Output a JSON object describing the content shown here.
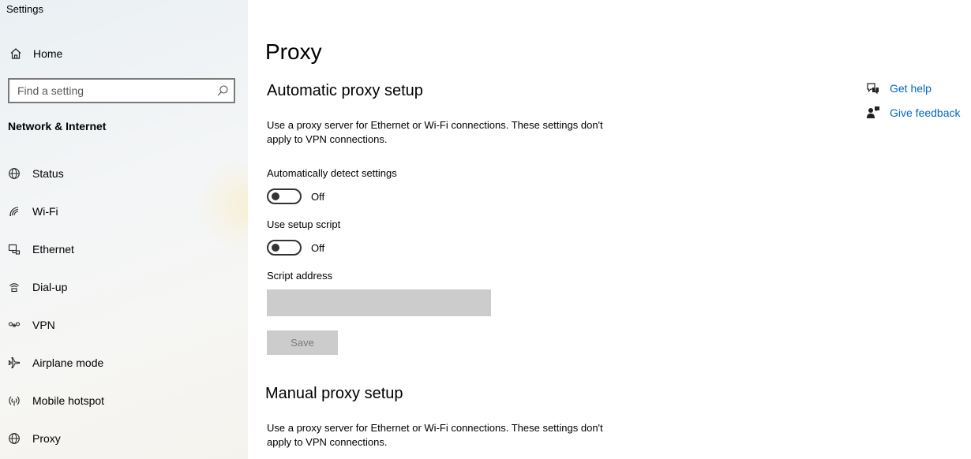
{
  "window": {
    "title": "Settings"
  },
  "sidebar": {
    "home": {
      "label": "Home",
      "icon": "home-icon"
    },
    "search": {
      "placeholder": "Find a setting",
      "value": ""
    },
    "section_title": "Network & Internet",
    "items": [
      {
        "label": "Status",
        "icon": "globe-icon"
      },
      {
        "label": "Wi-Fi",
        "icon": "wifi-icon"
      },
      {
        "label": "Ethernet",
        "icon": "ethernet-icon"
      },
      {
        "label": "Dial-up",
        "icon": "dialup-icon"
      },
      {
        "label": "VPN",
        "icon": "vpn-icon"
      },
      {
        "label": "Airplane mode",
        "icon": "airplane-icon"
      },
      {
        "label": "Mobile hotspot",
        "icon": "hotspot-icon"
      },
      {
        "label": "Proxy",
        "icon": "globe-icon"
      }
    ]
  },
  "main": {
    "title": "Proxy",
    "automatic": {
      "heading": "Automatic proxy setup",
      "description": "Use a proxy server for Ethernet or Wi-Fi connections. These settings don't apply to VPN connections.",
      "detect": {
        "label": "Automatically detect settings",
        "state": "Off",
        "on": false
      },
      "script": {
        "label": "Use setup script",
        "state": "Off",
        "on": false
      },
      "script_address": {
        "label": "Script address",
        "value": ""
      },
      "save_label": "Save"
    },
    "manual": {
      "heading": "Manual proxy setup",
      "description": "Use a proxy server for Ethernet or Wi-Fi connections. These settings don't apply to VPN connections."
    }
  },
  "help": {
    "get_help": "Get help",
    "give_feedback": "Give feedback"
  },
  "colors": {
    "link": "#0067c0",
    "disabled_bg": "#cccccc",
    "disabled_text": "#7a7a7a"
  }
}
